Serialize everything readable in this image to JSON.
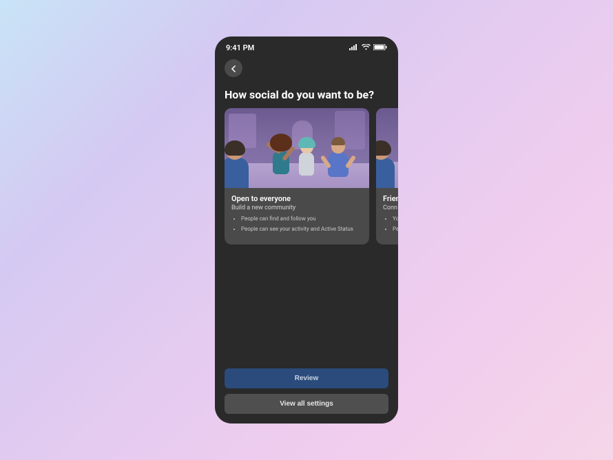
{
  "status": {
    "time": "9:41 PM"
  },
  "header": {
    "title": "How social do you want to be?"
  },
  "cards": [
    {
      "title": "Open to everyone",
      "subtitle": "Build a new community",
      "bullets": [
        "People can find and follow you",
        "People can see your activity and Active Status"
      ]
    },
    {
      "title": "Frien",
      "subtitle": "Conn",
      "bullets": [
        "Yo",
        "Pe an"
      ]
    }
  ],
  "footer": {
    "primary": "Review",
    "secondary": "View all settings"
  }
}
